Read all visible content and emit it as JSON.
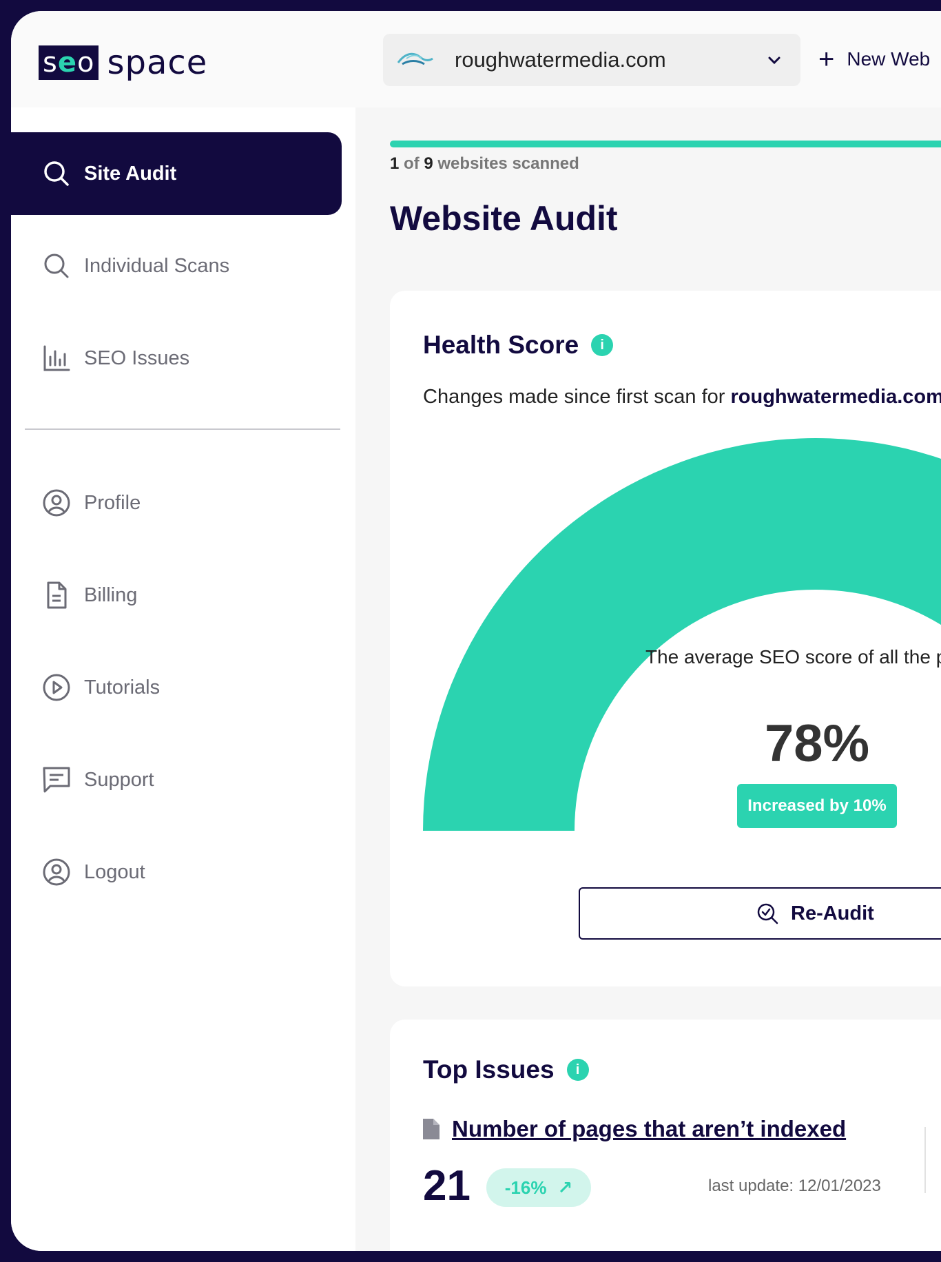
{
  "brand": {
    "logo_left": "seo",
    "logo_right": "space"
  },
  "header": {
    "site_select": {
      "value": "roughwatermedia.com"
    },
    "new_site_label": "New Web"
  },
  "sidebar": {
    "items": [
      {
        "label": "Site Audit",
        "icon": "search-icon",
        "active": true
      },
      {
        "label": "Individual Scans",
        "icon": "search-icon"
      },
      {
        "label": "SEO Issues",
        "icon": "bar-chart-icon"
      },
      {
        "label": "Profile",
        "icon": "user-circle-icon"
      },
      {
        "label": "Billing",
        "icon": "document-icon"
      },
      {
        "label": "Tutorials",
        "icon": "play-circle-icon"
      },
      {
        "label": "Support",
        "icon": "message-icon"
      },
      {
        "label": "Logout",
        "icon": "user-circle-icon"
      }
    ]
  },
  "scan": {
    "current": "1",
    "of": "of",
    "total": "9",
    "suffix": "websites scanned",
    "progress": 1.0
  },
  "page": {
    "title": "Website Audit"
  },
  "health": {
    "title": "Health Score",
    "subtitle_prefix": "Changes made since first scan for ",
    "subtitle_site": "roughwatermedia.com",
    "gauge_label": "The average SEO score of all the pages",
    "score_value": 78,
    "score_text": "78%",
    "badge": "Increased by 10%",
    "reaudit_label": "Re-Audit"
  },
  "top_issues": {
    "title": "Top Issues",
    "issue_label": "Number of pages that aren’t indexed",
    "count": "21",
    "delta": "-16%",
    "last_update": "last update: 12/01/2023"
  },
  "colors": {
    "brand": "#120a3f",
    "accent": "#2bd3b0",
    "accent_soft": "#d2f5ec"
  }
}
